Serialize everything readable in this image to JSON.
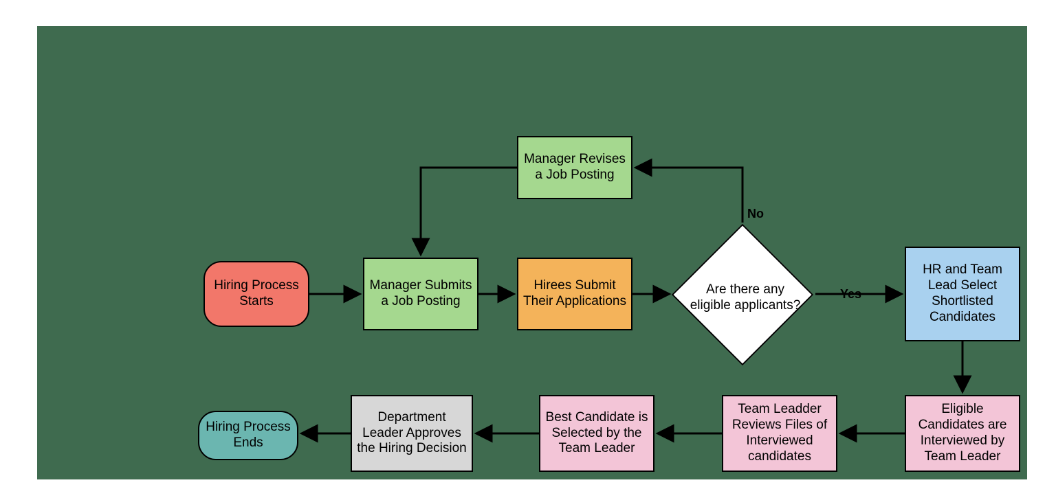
{
  "nodes": {
    "start": "Hiring Process Starts",
    "submit": "Manager Submits a Job Posting",
    "revise": "Manager Revises a Job Posting",
    "applications": "Hirees Submit Their Applications",
    "decision": "Are there any eligible applicants?",
    "shortlist": "HR and Team Lead Select Shortlisted Candidates",
    "interview": "Eligible Candidates are Interviewed by Team Leader",
    "review": "Team Leadder Reviews  Files of Interviewed candidates",
    "best": "Best Candidate is Selected by the Team Leader",
    "approve": "Department Leader Approves the  Hiring Decision",
    "end": "Hiring Process Ends"
  },
  "edgeLabels": {
    "no": "No",
    "yes": "Yes"
  },
  "colors": {
    "background": "#3f6b4f",
    "start": "#f2776a",
    "end": "#6bb6b0",
    "green": "#a5d88f",
    "orange": "#f4b35a",
    "blue": "#a9d1ef",
    "pink": "#f3c5d7",
    "grey": "#d7d7d7",
    "border": "#000000"
  }
}
